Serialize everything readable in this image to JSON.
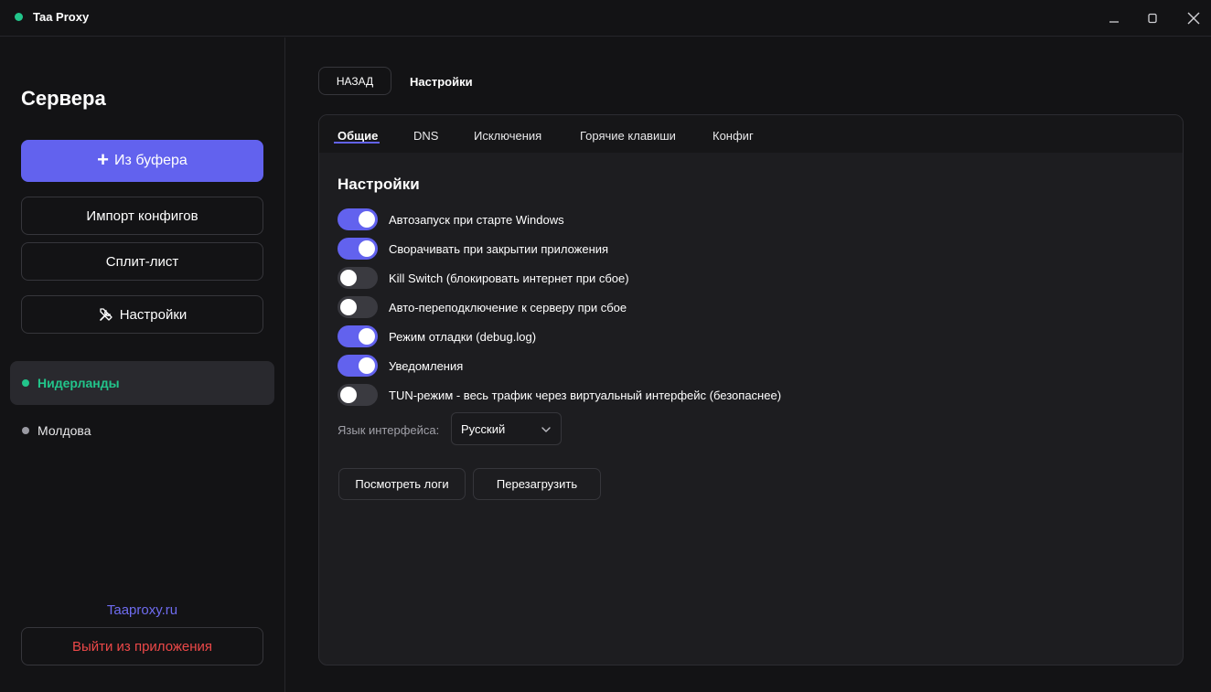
{
  "window": {
    "title": "Taa Proxy",
    "status_color": "#22c58b"
  },
  "sidebar": {
    "title": "Сервера",
    "clipboard_label": "Из буфера",
    "import_label": "Импорт конфигов",
    "split_label": "Сплит-лист",
    "settings_label": "Настройки",
    "servers": [
      {
        "name": "Нидерланды",
        "active": true
      },
      {
        "name": "Молдова",
        "active": false
      }
    ],
    "site_link": "Taaproxy.ru",
    "exit_label": "Выйти из приложения"
  },
  "header": {
    "back_label": "НАЗАД",
    "title": "Настройки"
  },
  "tabs": [
    {
      "label": "Общие",
      "active": true
    },
    {
      "label": "DNS",
      "active": false
    },
    {
      "label": "Исключения",
      "active": false
    },
    {
      "label": "Горячие клавиши",
      "active": false
    },
    {
      "label": "Конфиг",
      "active": false
    }
  ],
  "settings": {
    "section_title": "Настройки",
    "toggles": [
      {
        "label": "Автозапуск при старте Windows",
        "on": true
      },
      {
        "label": "Сворачивать при закрытии приложения",
        "on": true
      },
      {
        "label": "Kill Switch (блокировать интернет при сбое)",
        "on": false
      },
      {
        "label": "Авто-переподключение к серверу при сбое",
        "on": false
      },
      {
        "label": "Режим отладки (debug.log)",
        "on": true
      },
      {
        "label": "Уведомления",
        "on": true
      },
      {
        "label": "TUN-режим - весь трафик через виртуальный интерфейс (безопаснее)",
        "on": false
      }
    ],
    "language_label": "Язык интерфейса:",
    "language_value": "Русский",
    "view_logs_label": "Посмотреть логи",
    "restart_label": "Перезагрузить"
  },
  "colors": {
    "accent": "#6262ee",
    "online": "#22c58b",
    "danger": "#ec4848",
    "link": "#6f6cf0"
  }
}
